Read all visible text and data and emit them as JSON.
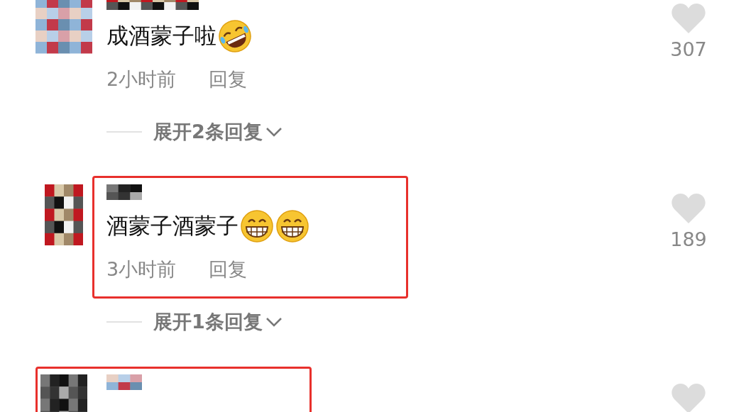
{
  "comments": [
    {
      "avatar": {
        "kind": "picture"
      },
      "text": "成酒蒙子啦",
      "emojis": [
        {
          "kind": "rofl"
        }
      ],
      "time": "2小时前",
      "reply": "回复",
      "likes": "307",
      "expand": "展开2条回复",
      "highlighted": false
    },
    {
      "avatar": {
        "kind": "picture"
      },
      "text": "酒蒙子酒蒙子",
      "emojis": [
        {
          "kind": "grin"
        },
        {
          "kind": "grin"
        }
      ],
      "time": "3小时前",
      "reply": "回复",
      "likes": "189",
      "expand": "展开1条回复",
      "highlighted": true
    },
    {
      "avatar": {
        "kind": "picture"
      },
      "highlighted": true
    }
  ]
}
